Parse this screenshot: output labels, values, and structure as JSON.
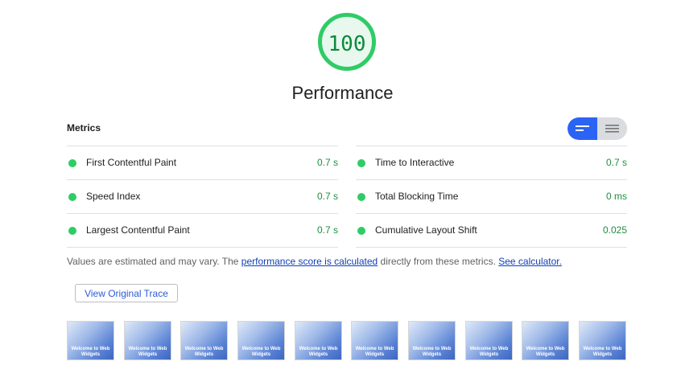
{
  "score": {
    "value": "100",
    "category": "Performance",
    "color": "#2fcc66"
  },
  "metrics": {
    "header": "Metrics",
    "toggle": {
      "active": "summary-view-icon",
      "inactive": "list-view-icon",
      "active_color": "#2b63f5"
    },
    "left": [
      {
        "label": "First Contentful Paint",
        "value": "0.7 s"
      },
      {
        "label": "Speed Index",
        "value": "0.7 s"
      },
      {
        "label": "Largest Contentful Paint",
        "value": "0.7 s"
      }
    ],
    "right": [
      {
        "label": "Time to Interactive",
        "value": "0.7 s"
      },
      {
        "label": "Total Blocking Time",
        "value": "0 ms"
      },
      {
        "label": "Cumulative Layout Shift",
        "value": "0.025"
      }
    ],
    "status_color": "#2fcc66"
  },
  "note": {
    "prefix": "Values are estimated and may vary. The ",
    "link1": "performance score is calculated",
    "middle": " directly from these metrics. ",
    "link2": "See calculator."
  },
  "trace_button": "View Original Trace",
  "filmstrip": {
    "frame_text": "Welcome to Web Widgets",
    "frame_count": 10
  }
}
